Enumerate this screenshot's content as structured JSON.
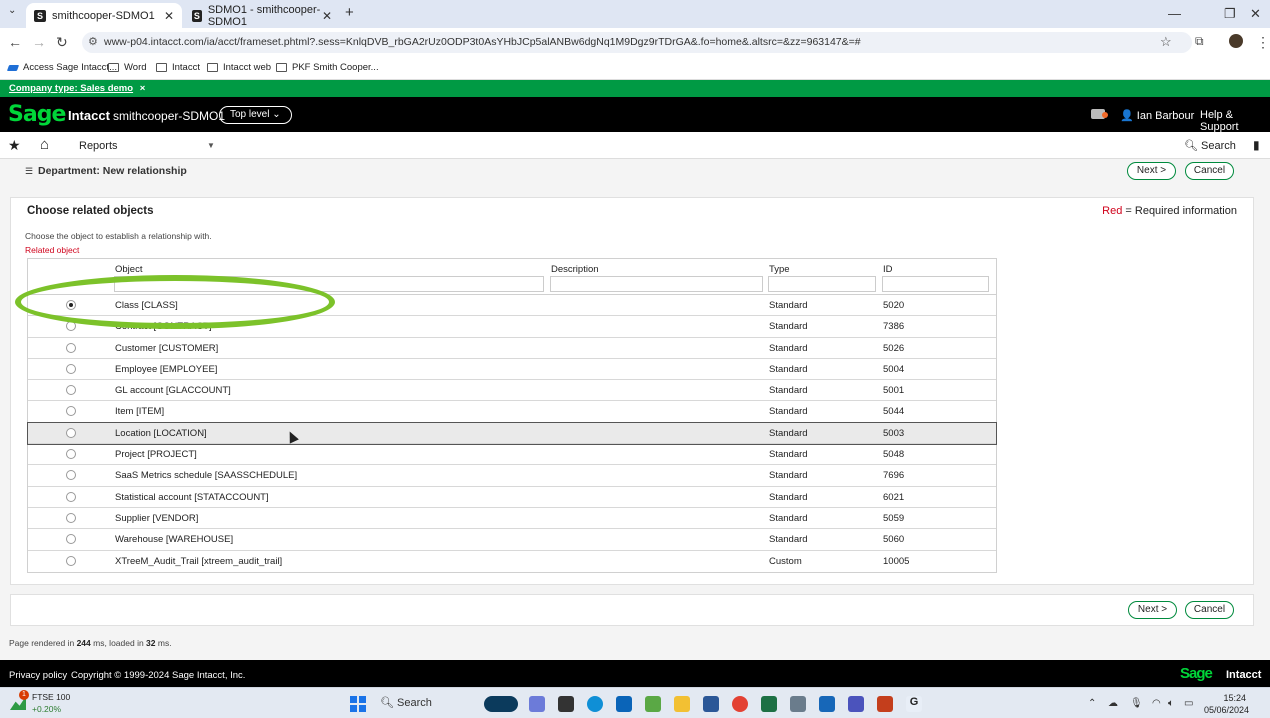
{
  "browser": {
    "tabs": [
      {
        "title": "smithcooper-SDMO1",
        "favicon": "S"
      },
      {
        "title": "SDMO1 - smithcooper-SDMO1",
        "favicon": "S"
      }
    ],
    "new_tab": "+",
    "url": "www-p04.intacct.com/ia/acct/frameset.phtml?.sess=KnlqDVB_rbGA2rUz0ODP3t0AsYHbJCp5alANBw6dgNq1M9Dgz9rTDrGA&.fo=home&.altsrc=&zz=963147&=#",
    "bookmarks": [
      "Access Sage Intacct...",
      "Word",
      "Intacct",
      "Intacct web",
      "PKF Smith Cooper..."
    ]
  },
  "header": {
    "company_type_label": "Company type: Sales demo",
    "company_type_close": "×",
    "logo": "Sage",
    "product": "Intacct",
    "company": "smithcooper-SDMO1",
    "level": "Top level",
    "user": "Ian Barbour",
    "help": "Help & Support"
  },
  "nav": {
    "reports": "Reports",
    "search": "Search"
  },
  "page": {
    "title": "Department: New relationship",
    "next": "Next >",
    "cancel": "Cancel",
    "panel_title": "Choose related objects",
    "required_red": "Red",
    "required_rest": " = Required information",
    "instruction": "Choose the object to establish a relationship with.",
    "related_label": "Related object",
    "columns": {
      "object": "Object",
      "description": "Description",
      "type": "Type",
      "id": "ID"
    },
    "rows": [
      {
        "object": "Class [CLASS]",
        "type": "Standard",
        "id": "5020",
        "selected": true
      },
      {
        "object": "Contract [CONTRACT]",
        "type": "Standard",
        "id": "7386",
        "selected": false
      },
      {
        "object": "Customer [CUSTOMER]",
        "type": "Standard",
        "id": "5026",
        "selected": false
      },
      {
        "object": "Employee [EMPLOYEE]",
        "type": "Standard",
        "id": "5004",
        "selected": false
      },
      {
        "object": "GL account [GLACCOUNT]",
        "type": "Standard",
        "id": "5001",
        "selected": false
      },
      {
        "object": "Item [ITEM]",
        "type": "Standard",
        "id": "5044",
        "selected": false
      },
      {
        "object": "Location [LOCATION]",
        "type": "Standard",
        "id": "5003",
        "selected": false
      },
      {
        "object": "Project [PROJECT]",
        "type": "Standard",
        "id": "5048",
        "selected": false
      },
      {
        "object": "SaaS Metrics schedule [SAASSCHEDULE]",
        "type": "Standard",
        "id": "7696",
        "selected": false
      },
      {
        "object": "Statistical account [STATACCOUNT]",
        "type": "Standard",
        "id": "6021",
        "selected": false
      },
      {
        "object": "Supplier [VENDOR]",
        "type": "Standard",
        "id": "5059",
        "selected": false
      },
      {
        "object": "Warehouse [WAREHOUSE]",
        "type": "Standard",
        "id": "5060",
        "selected": false
      },
      {
        "object": "XTreeM_Audit_Trail [xtreem_audit_trail]",
        "type": "Custom",
        "id": "10005",
        "selected": false
      }
    ],
    "render_prefix": "Page rendered in ",
    "render_ms": "244",
    "render_mid": " ms, loaded in ",
    "load_ms": "32",
    "render_suffix": " ms."
  },
  "footer": {
    "privacy": "Privacy policy",
    "copyright": "Copyright © 1999-2024 Sage Intacct, Inc.",
    "logo": "Sage",
    "product": "Intacct"
  },
  "taskbar": {
    "ticker": "FTSE 100",
    "change": "+0.20%",
    "notifications": "1",
    "search": "Search",
    "time": "15:24",
    "date": "05/06/2024"
  },
  "colors": {
    "sage_green": "#00d639",
    "company_bar": "#009a44",
    "required_red": "#d0021b",
    "highlight_oval": "#7cc22a"
  }
}
